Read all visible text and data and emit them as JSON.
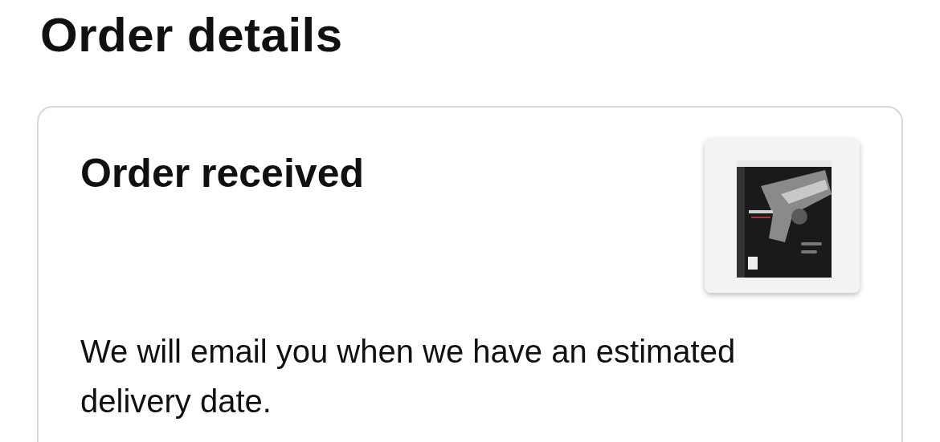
{
  "page_title": "Order details",
  "order_card": {
    "status": "Order received",
    "message": "We will email you when we have an estimated delivery date."
  }
}
